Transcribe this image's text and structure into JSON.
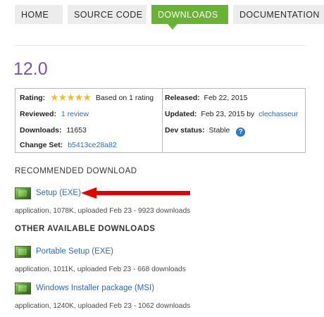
{
  "tabs": [
    {
      "label": "HOME"
    },
    {
      "label": "SOURCE CODE"
    },
    {
      "label": "DOWNLOADS"
    },
    {
      "label": "DOCUMENTATION"
    }
  ],
  "active_tab": "DOWNLOADS",
  "version_title": "12.0",
  "info": {
    "rating_label": "Rating:",
    "rating_stars": 5,
    "rating_text": "Based on 1 rating",
    "reviewed_label": "Reviewed:",
    "reviewed_value": "1 review",
    "downloads_label": "Downloads:",
    "downloads_value": "11653",
    "changeset_label": "Change Set:",
    "changeset_value": "b5413ce28a82",
    "released_label": "Released:",
    "released_value": "Feb 22, 2015",
    "updated_label": "Updated:",
    "updated_value": "Feb 23, 2015 by",
    "updated_user": "clechasseur",
    "devstatus_label": "Dev status:",
    "devstatus_value": "Stable",
    "help_glyph": "?"
  },
  "recommended_heading": "RECOMMENDED DOWNLOAD",
  "recommended": {
    "name": "Setup (EXE)",
    "meta": "application, 1078K, uploaded Feb 23 - 9923 downloads"
  },
  "other_heading": "OTHER AVAILABLE DOWNLOADS",
  "others": [
    {
      "name": "Portable Setup (EXE)",
      "meta": "application, 1011K, uploaded Feb 23 - 668 downloads"
    },
    {
      "name": "Windows Installer package (MSI)",
      "meta": "application, 1240K, uploaded Feb 23 - 1062 downloads"
    }
  ],
  "colors": {
    "accent_green": "#68b334",
    "version_purple": "#7b53a3",
    "link_blue": "#2c6bb5",
    "arrow_red": "#e30000",
    "star_gold": "#f2bf1f"
  },
  "icons": {
    "download_file": "green-installer-icon",
    "help": "help-circle-icon",
    "star": "star-icon",
    "pointer": "red-arrow-icon"
  }
}
